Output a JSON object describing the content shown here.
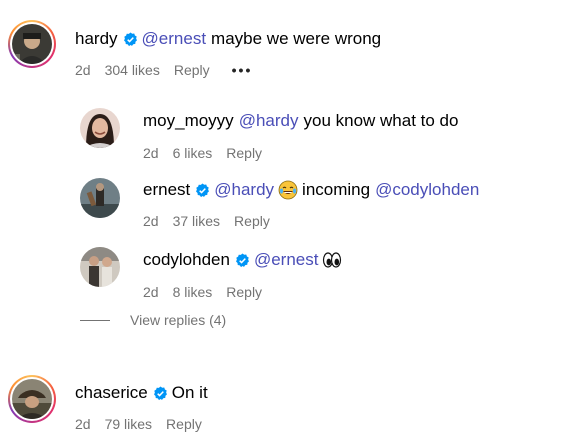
{
  "colors": {
    "mention": "#4a4eb7",
    "meta": "#737373",
    "verified": "#0095f6"
  },
  "comments": [
    {
      "username": "hardy",
      "verified": true,
      "mention": "@ernest",
      "text": "maybe we were wrong",
      "age": "2d",
      "likes": "304 likes",
      "reply": "Reply",
      "more": "•••",
      "story_ring": true
    },
    {
      "username": "moy_moyyy",
      "verified": false,
      "mention": "@hardy",
      "text": "you know what to do",
      "age": "2d",
      "likes": "6 likes",
      "reply": "Reply"
    },
    {
      "username": "ernest",
      "verified": true,
      "mention": "@hardy",
      "emoji": "face-with-tears-of-joy",
      "text": "incoming",
      "mention2": "@codylohden",
      "age": "2d",
      "likes": "37 likes",
      "reply": "Reply"
    },
    {
      "username": "codylohden",
      "verified": true,
      "mention": "@ernest",
      "emoji": "eyes",
      "age": "2d",
      "likes": "8 likes",
      "reply": "Reply"
    },
    {
      "username": "chaserice",
      "verified": true,
      "text": "On it",
      "age": "2d",
      "likes": "79 likes",
      "reply": "Reply",
      "story_ring": true
    }
  ],
  "view_replies": "View replies (4)"
}
